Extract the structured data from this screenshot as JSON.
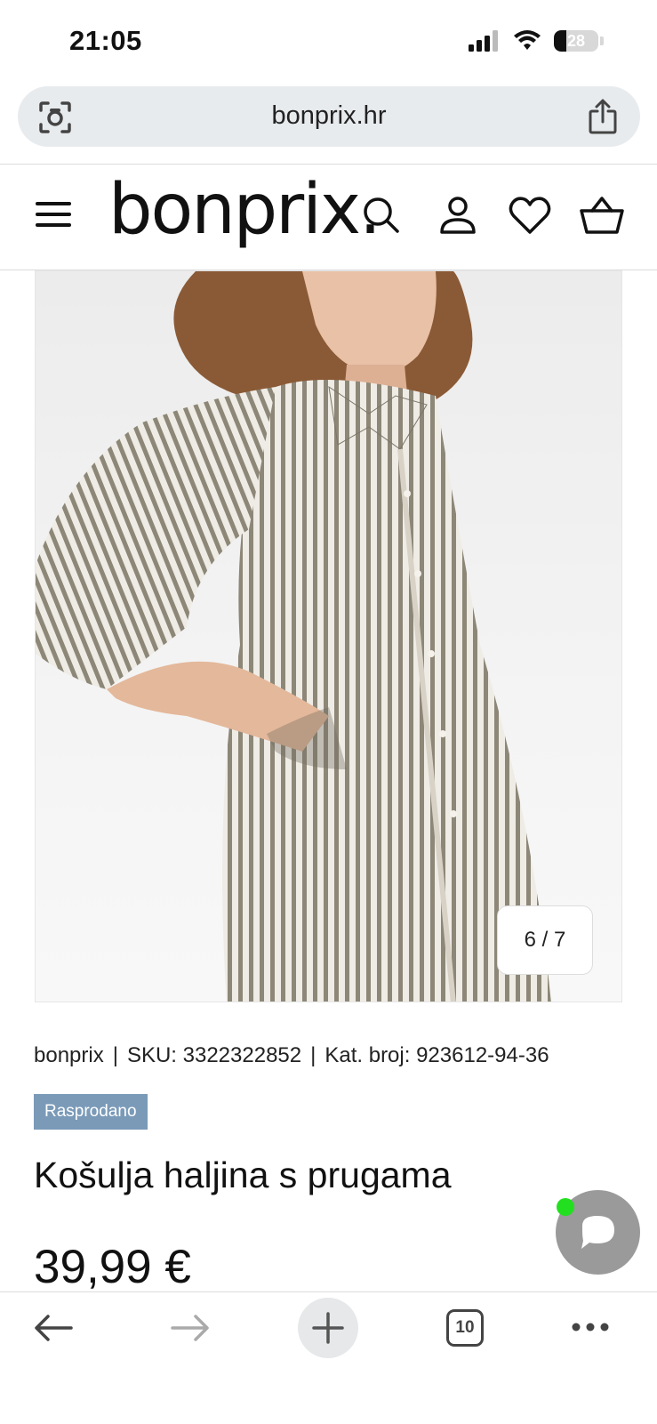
{
  "status_bar": {
    "time": "21:05",
    "battery": "28"
  },
  "browser": {
    "url": "bonprix.hr",
    "tabs_count": "10"
  },
  "site": {
    "logo": "bonprix."
  },
  "gallery": {
    "counter": "6 / 7"
  },
  "product": {
    "brand": "bonprix",
    "sku": "SKU: 3322322852",
    "catalog": "Kat. broj: 923612-94-36",
    "badge": "Rasprodano",
    "title": "Košulja haljina s prugama",
    "price": "39,99 €"
  },
  "colors": {
    "badge_bg": "#7a9ab8",
    "chat_fab": "#9a9a9a",
    "online": "#22e01f"
  }
}
